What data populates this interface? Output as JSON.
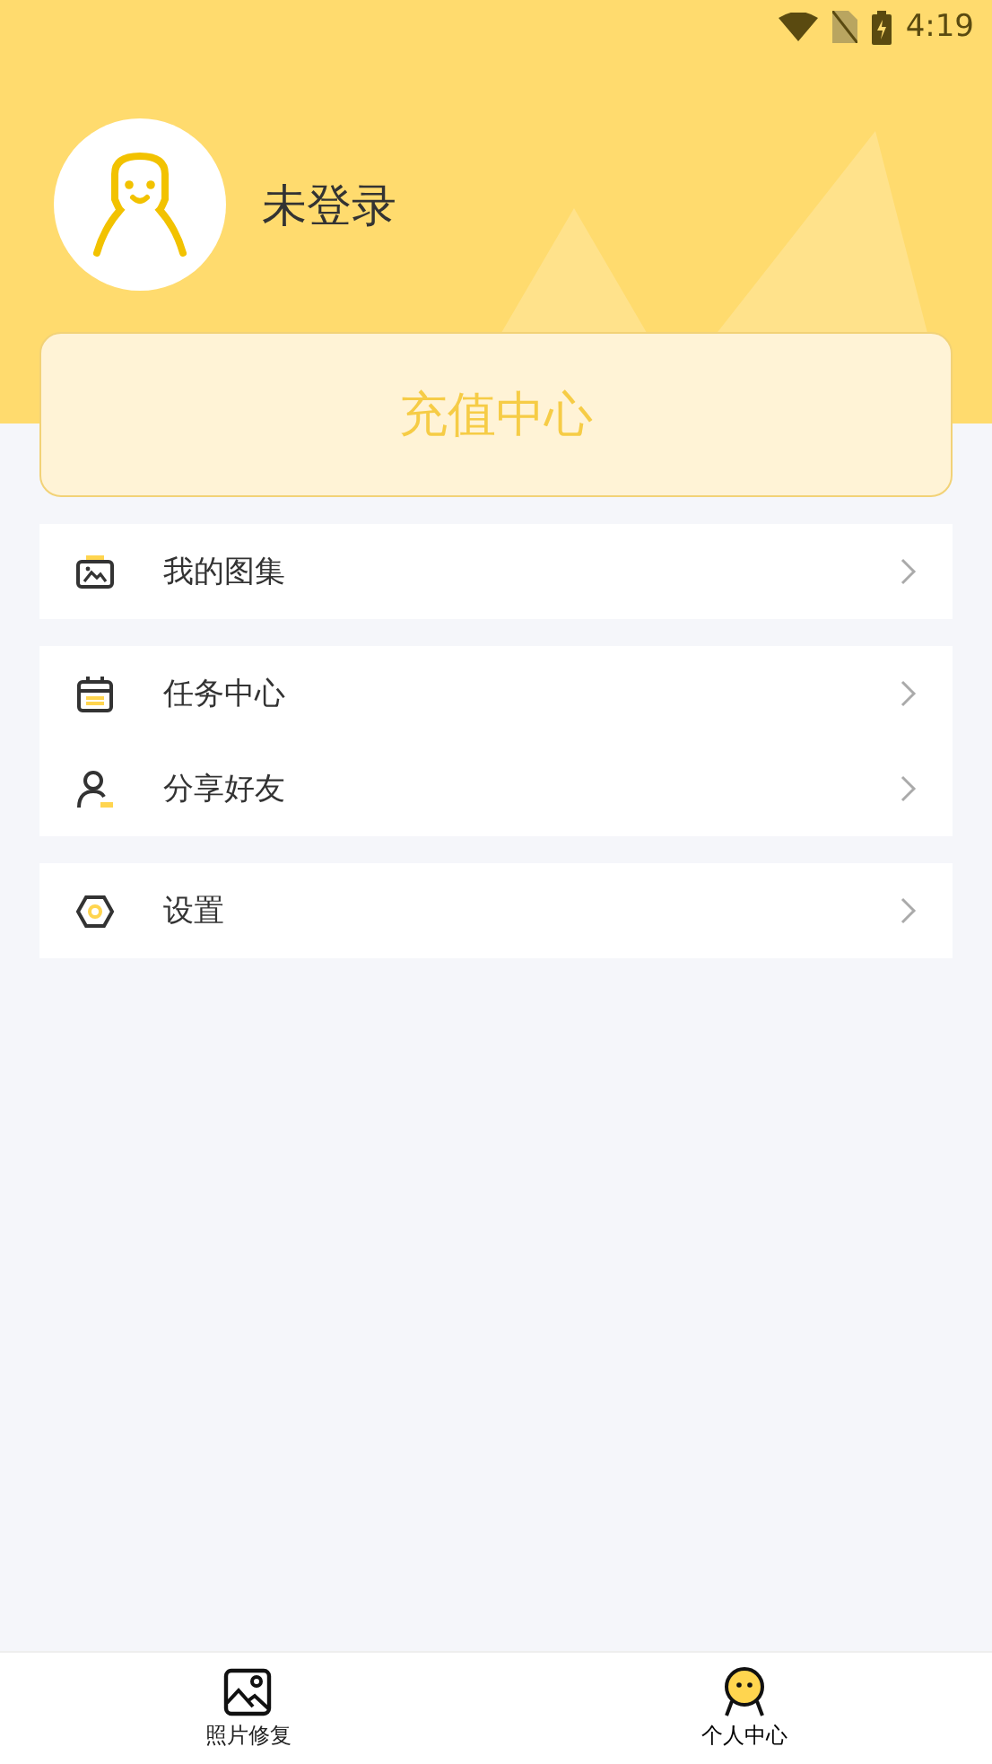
{
  "status_bar": {
    "time": "4:19"
  },
  "profile": {
    "name": "未登录"
  },
  "recharge": {
    "label": "充值中心"
  },
  "menu_groups": [
    {
      "items": [
        {
          "kind": "album",
          "label": "我的图集"
        }
      ]
    },
    {
      "items": [
        {
          "kind": "tasks",
          "label": "任务中心"
        },
        {
          "kind": "share",
          "label": "分享好友"
        }
      ]
    },
    {
      "items": [
        {
          "kind": "settings",
          "label": "设置"
        }
      ]
    }
  ],
  "bottom_nav": [
    {
      "kind": "photo",
      "label": "照片修复",
      "selected": false
    },
    {
      "kind": "me",
      "label": "个人中心",
      "selected": true
    }
  ]
}
